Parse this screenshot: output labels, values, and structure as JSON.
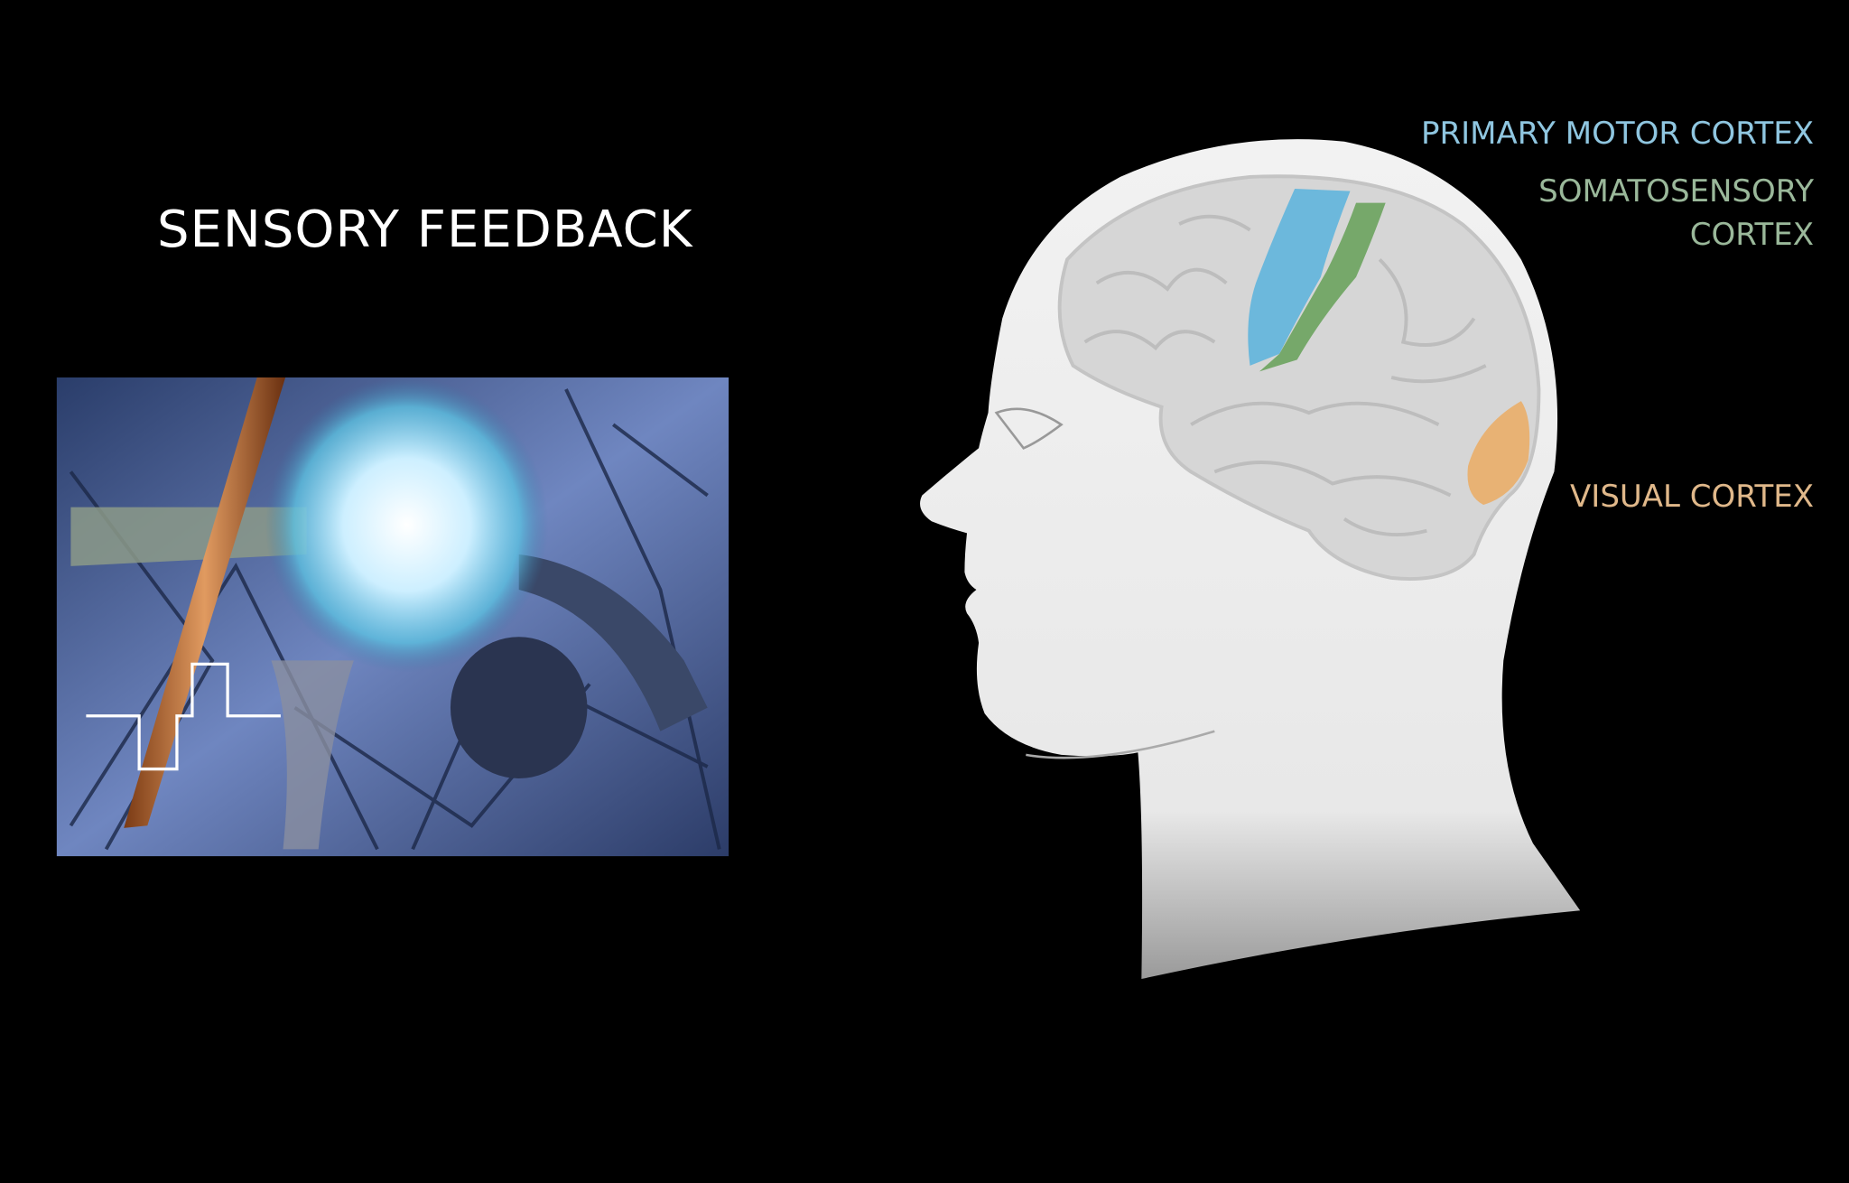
{
  "slide": {
    "title": "SENSORY FEEDBACK"
  },
  "labels": {
    "primary_motor_cortex": "PRIMARY MOTOR CORTEX",
    "somatosensory_line1": "SOMATOSENSORY",
    "somatosensory_line2": "CORTEX",
    "visual_cortex": "VISUAL CORTEX"
  },
  "colors": {
    "motor": "#6cb8dc",
    "somatosensory": "#76a86a",
    "visual": "#e8b274"
  }
}
